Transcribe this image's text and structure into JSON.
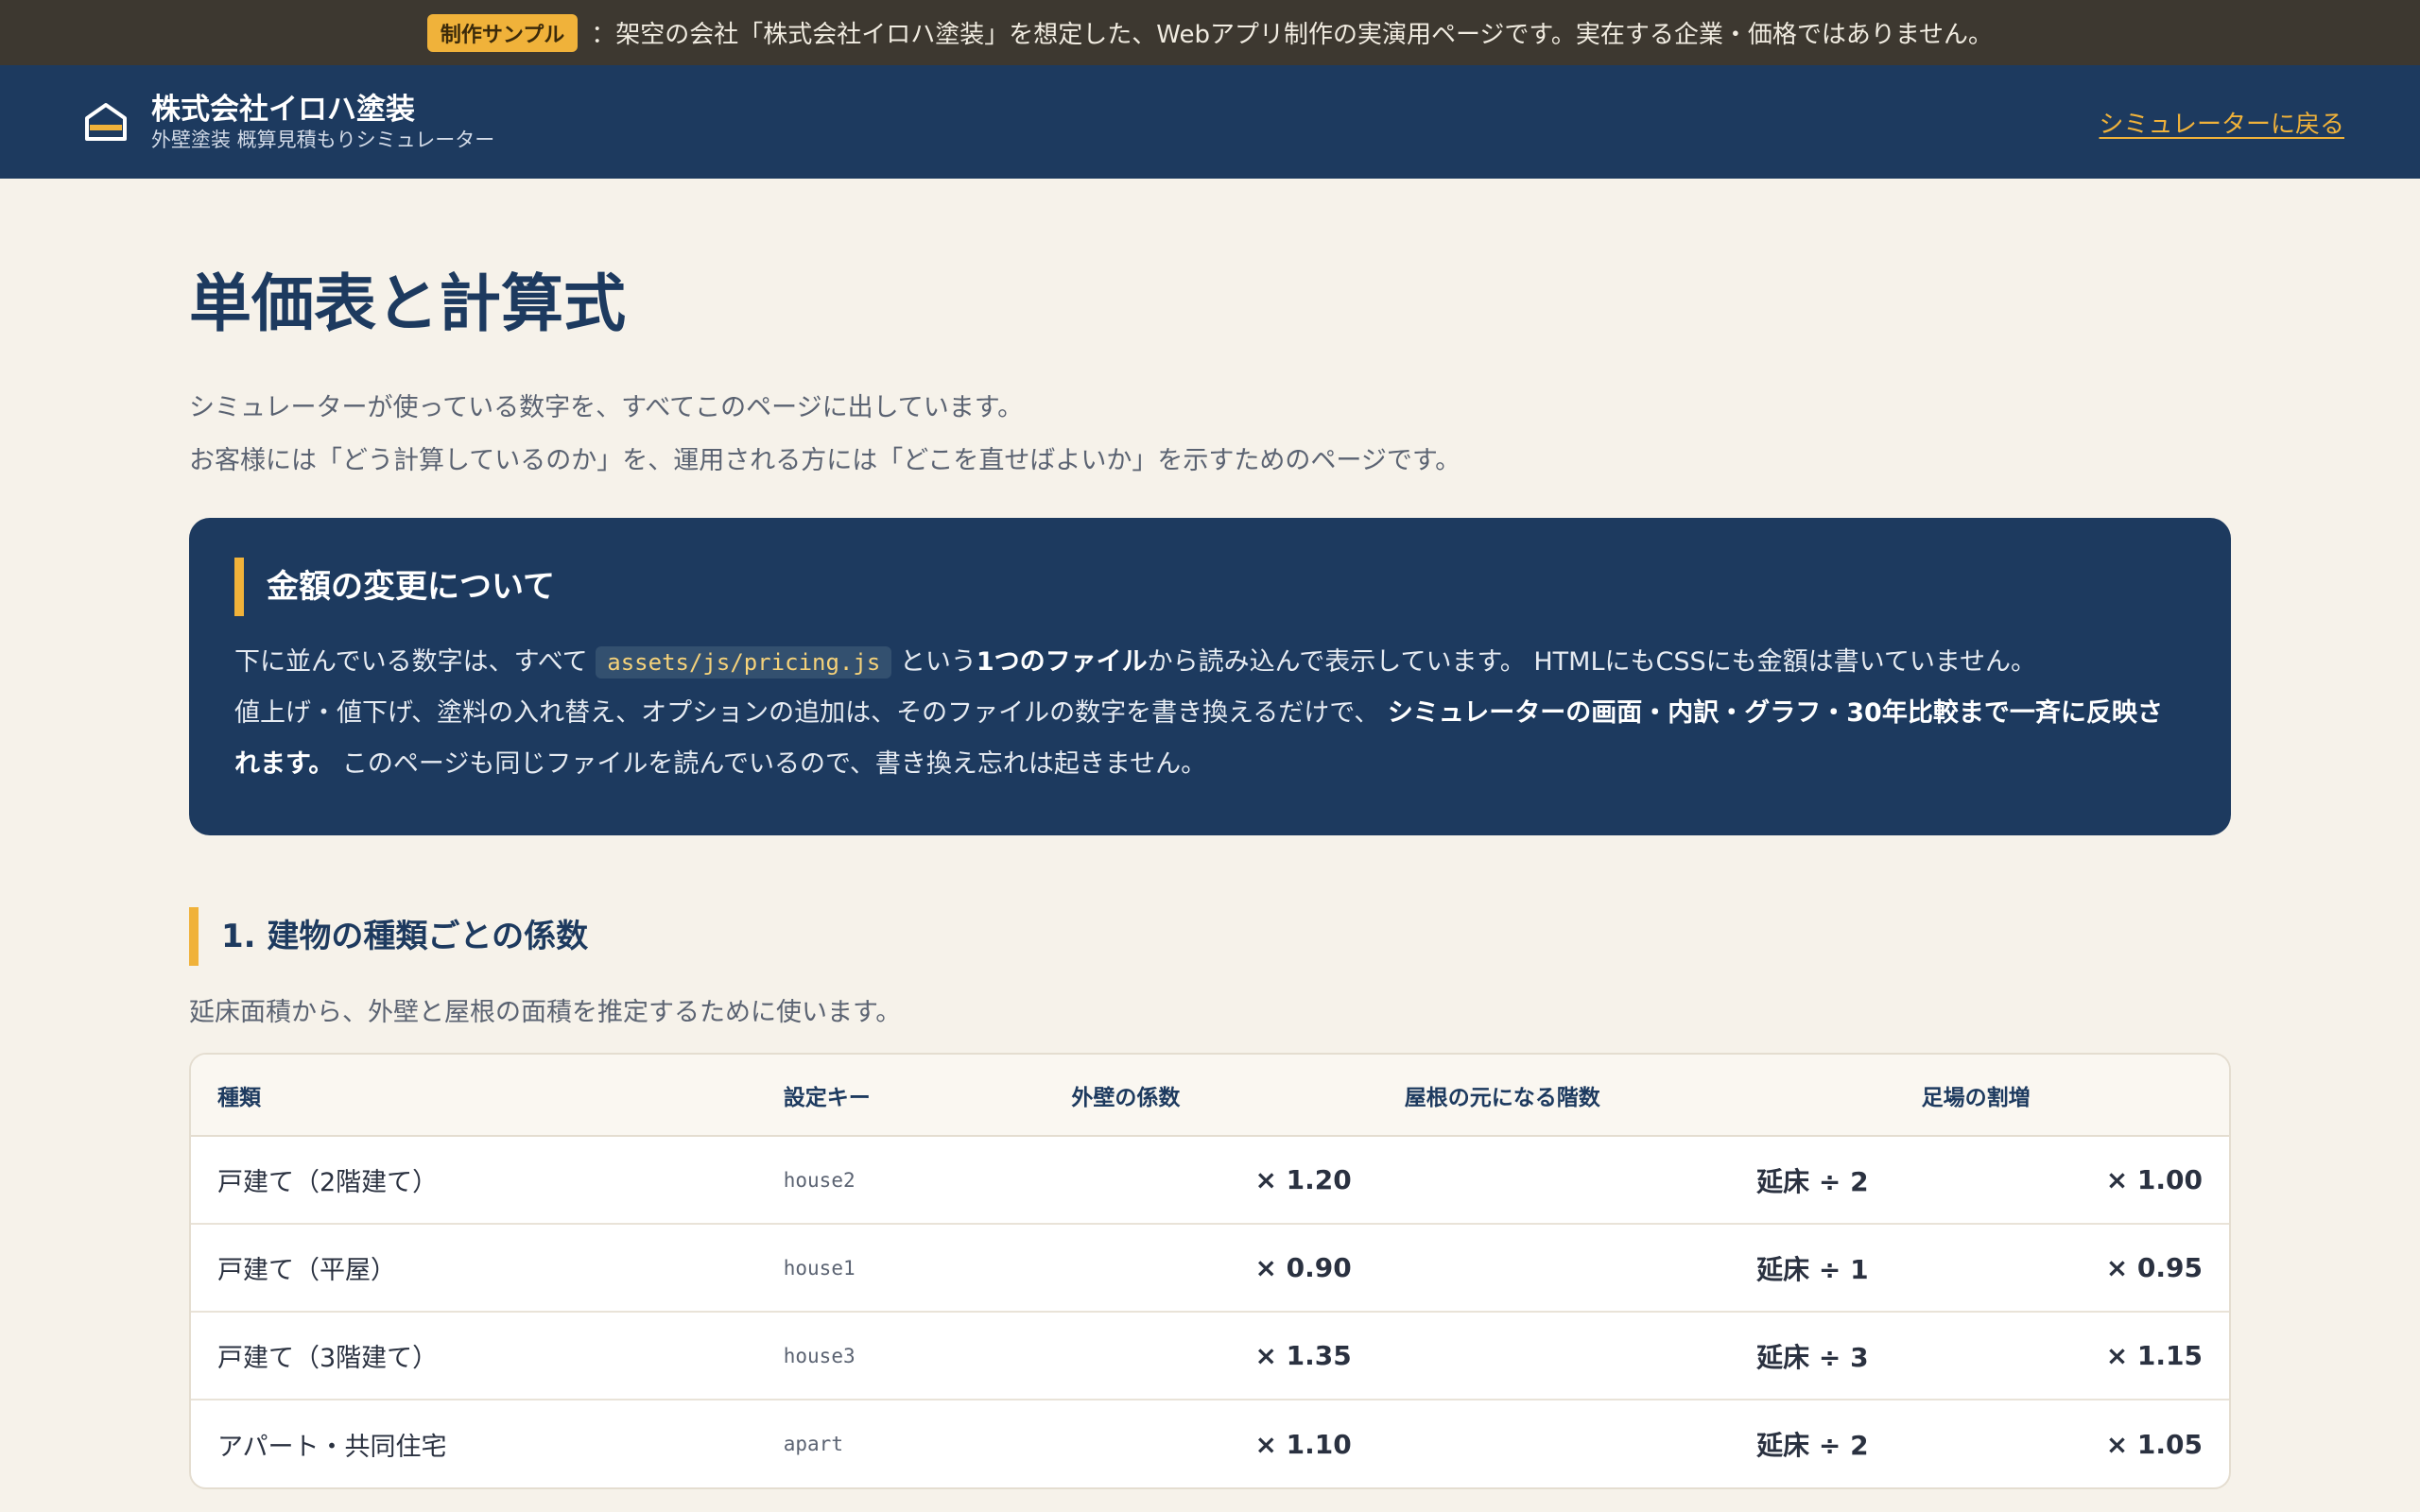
{
  "sample_bar": {
    "badge": "制作サンプル",
    "text": "：架空の会社「株式会社イロハ塗装」を想定した、Webアプリ制作の実演用ページです。実在する企業・価格ではありません。"
  },
  "header": {
    "company": "株式会社イロハ塗装",
    "subtitle": "外壁塗装 概算見積もりシミュレーター",
    "back_link": "シミュレーターに戻る",
    "icon": "house-icon"
  },
  "page": {
    "title": "単価表と計算式",
    "intro_1": "シミュレーターが使っている数字を、すべてこのページに出しています。",
    "intro_2": "お客様には「どう計算しているのか」を、運用される方には「どこを直せばよいか」を示すためのページです。"
  },
  "notice": {
    "heading": "金額の変更について",
    "p1_a": "下に並んでいる数字は、すべて",
    "p1_code": "assets/js/pricing.js",
    "p1_b": "という",
    "p1_bold": "1つのファイル",
    "p1_c": "から読み込んで表示しています。 HTMLにもCSSにも金額は書いていません。",
    "p2_a": "値上げ・値下げ、塗料の入れ替え、オプションの追加は、そのファイルの数字を書き換えるだけで、",
    "p2_bold": "シミュレーターの画面・内訳・グラフ・30年比較まで一斉に反映されます。",
    "p2_b": "このページも同じファイルを読んでいるので、書き換え忘れは起きません。"
  },
  "section1": {
    "heading": "1. 建物の種類ごとの係数",
    "desc": "延床面積から、外壁と屋根の面積を推定するために使います。",
    "columns": [
      "種類",
      "設定キー",
      "外壁の係数",
      "屋根の元になる階数",
      "足場の割増"
    ],
    "rows": [
      {
        "type": "戸建て（2階建て）",
        "key": "house2",
        "wall": "× 1.20",
        "roof": "延床 ÷ 2",
        "scaffold": "× 1.00"
      },
      {
        "type": "戸建て（平屋）",
        "key": "house1",
        "wall": "× 0.90",
        "roof": "延床 ÷ 1",
        "scaffold": "× 0.95"
      },
      {
        "type": "戸建て（3階建て）",
        "key": "house3",
        "wall": "× 1.35",
        "roof": "延床 ÷ 3",
        "scaffold": "× 1.15"
      },
      {
        "type": "アパート・共同住宅",
        "key": "apart",
        "wall": "× 1.10",
        "roof": "延床 ÷ 2",
        "scaffold": "× 1.05"
      }
    ]
  },
  "colors": {
    "navy": "#1d3a5f",
    "accent": "#f0b23a",
    "background": "#f6f2ea",
    "sample_bar": "#3d3830"
  }
}
